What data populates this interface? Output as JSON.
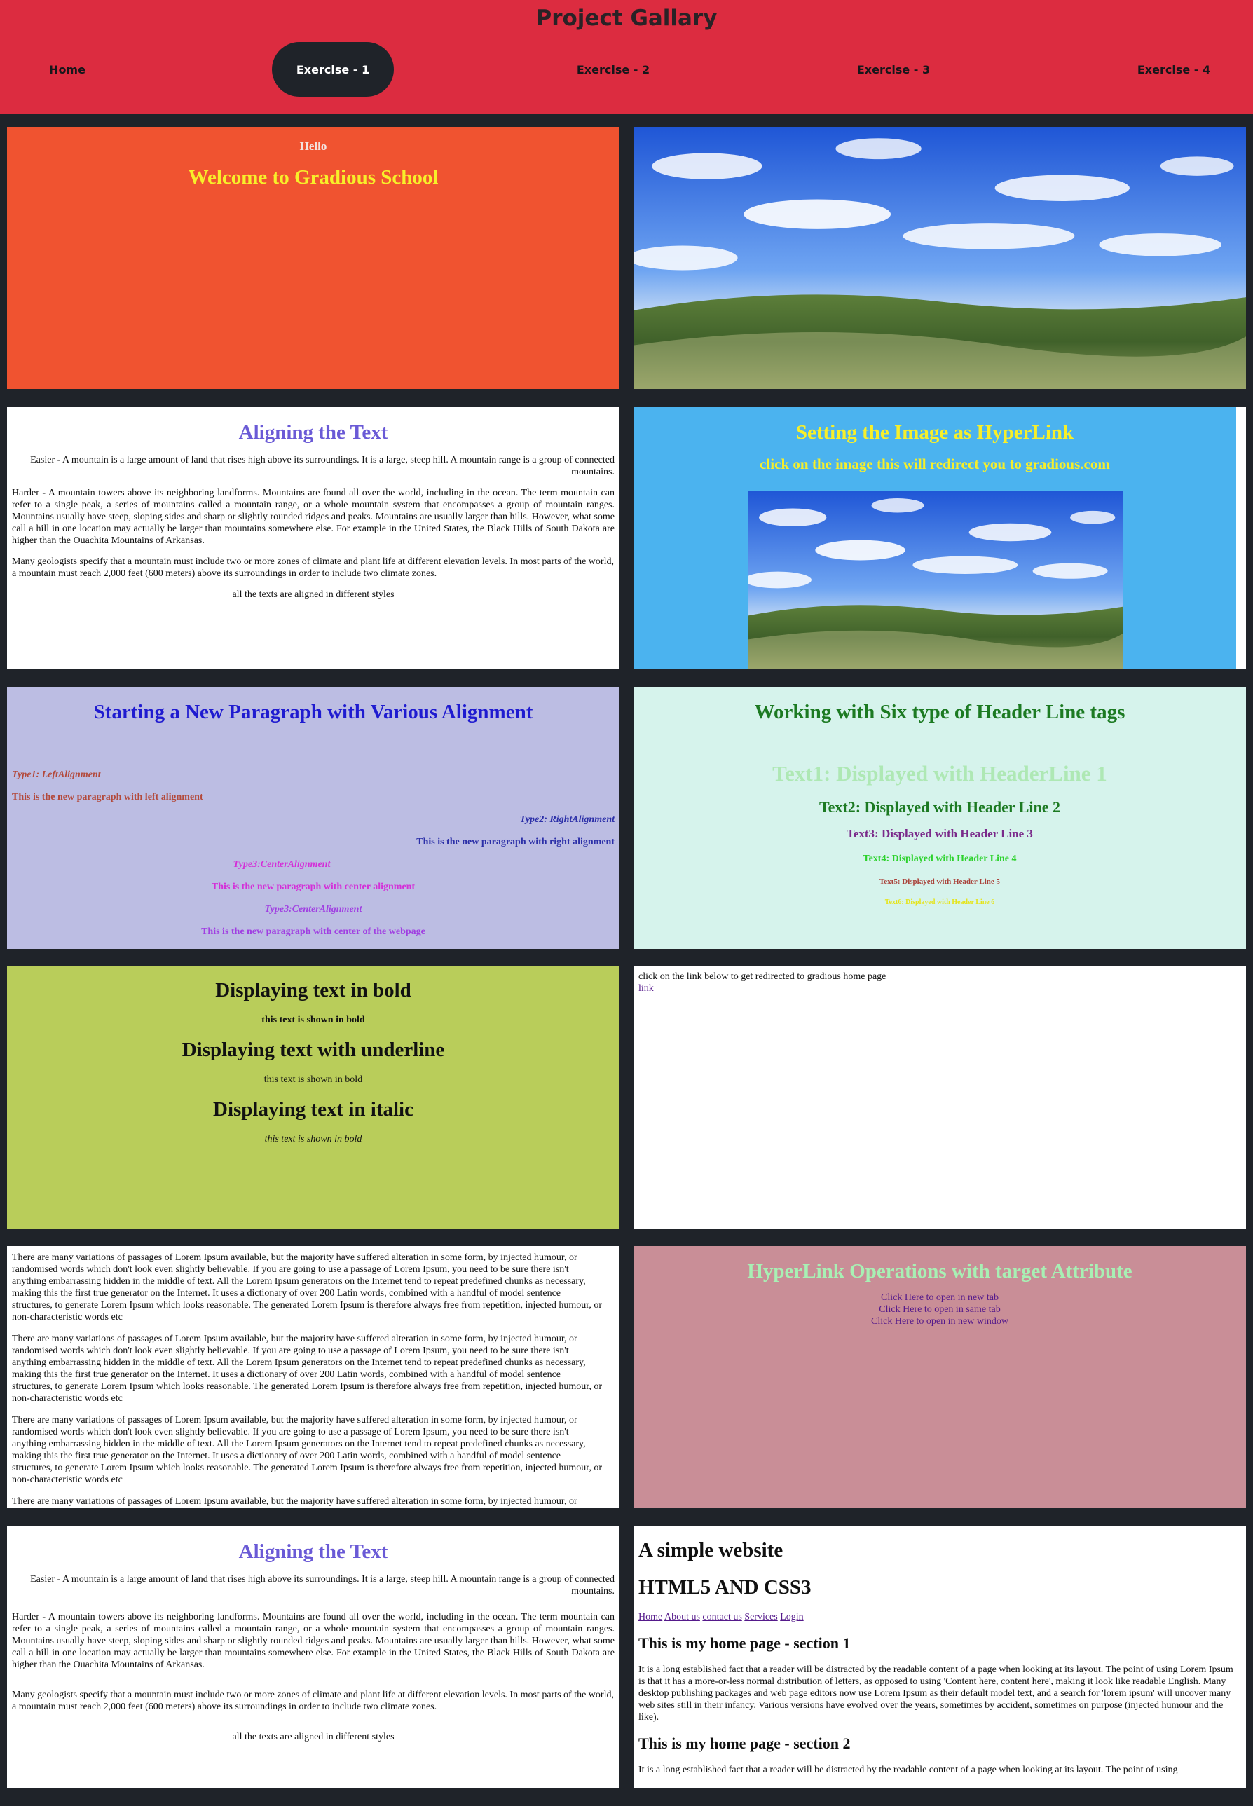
{
  "header": {
    "title": "Project Gallary",
    "nav": [
      {
        "label": "Home"
      },
      {
        "label": "Exercise - 1"
      },
      {
        "label": "Exercise - 2"
      },
      {
        "label": "Exercise - 3"
      },
      {
        "label": "Exercise - 4"
      }
    ]
  },
  "colors": {
    "header_bg": "#dc2c40",
    "page_bg": "#1f2329",
    "nav_active_bg": "#1f2329",
    "panel_orange": "#f05330",
    "panel_blue": "#4bb3ef",
    "panel_lavender": "#bcbde3",
    "panel_mint": "#d6f3ec",
    "panel_olive": "#b9cd5a",
    "panel_rose": "#c98e97"
  },
  "welcome": {
    "hello": "Hello",
    "heading": "Welcome to Gradious School"
  },
  "align": {
    "heading": "Aligning the Text",
    "easier": "Easier - A mountain is a large amount of land that rises high above its surroundings. It is a large, steep hill. A mountain range is a group of connected mountains.",
    "harder": "Harder - A mountain towers above its neighboring landforms. Mountains are found all over the world, including in the ocean. The term mountain can refer to a single peak, a series of mountains called a mountain range, or a whole mountain system that encompasses a group of mountain ranges. Mountains usually have steep, sloping sides and sharp or slightly rounded ridges and peaks. Mountains are usually larger than hills. However, what some call a hill in one location may actually be larger than mountains somewhere else. For example in the United States, the Black Hills of South Dakota are higher than the Ouachita Mountains of Arkansas.",
    "geologists": "Many geologists specify that a mountain must include two or more zones of climate and plant life at different elevation levels. In most parts of the world, a mountain must reach 2,000 feet (600 meters) above its surroundings in order to include two climate zones.",
    "footer": "all the texts are aligned in different styles"
  },
  "image_link": {
    "heading": "Setting the Image as HyperLink",
    "sub": "click on the image this will redirect you to gradious.com"
  },
  "paragraphs": {
    "heading": "Starting a New Paragraph with Various Alignment",
    "items": [
      {
        "label": "Type1: LeftAlignment",
        "text": "This is the new paragraph with left alignment"
      },
      {
        "label": "Type2: RightAlignment",
        "text": "This is the new paragraph with right alignment"
      },
      {
        "label": "Type3:CenterAlignment",
        "text": "This is the new paragraph with center alignment"
      },
      {
        "label": "Type3:CenterAlignment",
        "text": "This is the new paragraph with center of the webpage"
      }
    ]
  },
  "headers": {
    "heading": "Working with Six type of Header Line tags",
    "lines": [
      "Text1: Displayed with HeaderLine 1",
      "Text2: Displayed with Header Line 2",
      "Text3: Displayed with Header Line 3",
      "Text4: Displayed with Header Line 4",
      "Text5: Displayed with Header Line 5",
      "Text6: Displayed with Header Line 6"
    ]
  },
  "formatting": {
    "bold_heading": "Displaying text in bold",
    "bold_text": "this text is shown in bold",
    "underline_heading": "Displaying text with underline",
    "underline_text": "this text is shown in bold",
    "italic_heading": "Displaying text in italic",
    "italic_text": "this text is shown in bold"
  },
  "redirect": {
    "text": "click on the link below to get redirected to gradious home page",
    "link": "link"
  },
  "lorem": {
    "para": "There are many variations of passages of Lorem Ipsum available, but the majority have suffered alteration in some form, by injected humour, or randomised words which don't look even slightly believable. If you are going to use a passage of Lorem Ipsum, you need to be sure there isn't anything embarrassing hidden in the middle of text. All the Lorem Ipsum generators on the Internet tend to repeat predefined chunks as necessary, making this the first true generator on the Internet. It uses a dictionary of over 200 Latin words, combined with a handful of model sentence structures, to generate Lorem Ipsum which looks reasonable. The generated Lorem Ipsum is therefore always free from repetition, injected humour, or non-characteristic words etc"
  },
  "target": {
    "heading": "HyperLink Operations with target Attribute",
    "links": [
      "Click Here to open in new tab",
      "Click Here to open in same tab",
      "Click Here to open in new window"
    ]
  },
  "website": {
    "title": "A simple website",
    "sub": "HTML5 AND CSS3",
    "nav": [
      "Home",
      "About us",
      "contact us",
      "Services",
      "Login"
    ],
    "section1": "This is my home page - section 1",
    "section1_text": "It is a long established fact that a reader will be distracted by the readable content of a page when looking at its layout. The point of using Lorem Ipsum is that it has a more-or-less normal distribution of letters, as opposed to using 'Content here, content here', making it look like readable English. Many desktop publishing packages and web page editors now use Lorem Ipsum as their default model text, and a search for 'lorem ipsum' will uncover many web sites still in their infancy. Various versions have evolved over the years, sometimes by accident, sometimes on purpose (injected humour and the like).",
    "section2": "This is my home page - section 2",
    "section2_text": "It is a long established fact that a reader will be distracted by the readable content of a page when looking at its layout. The point of using"
  }
}
